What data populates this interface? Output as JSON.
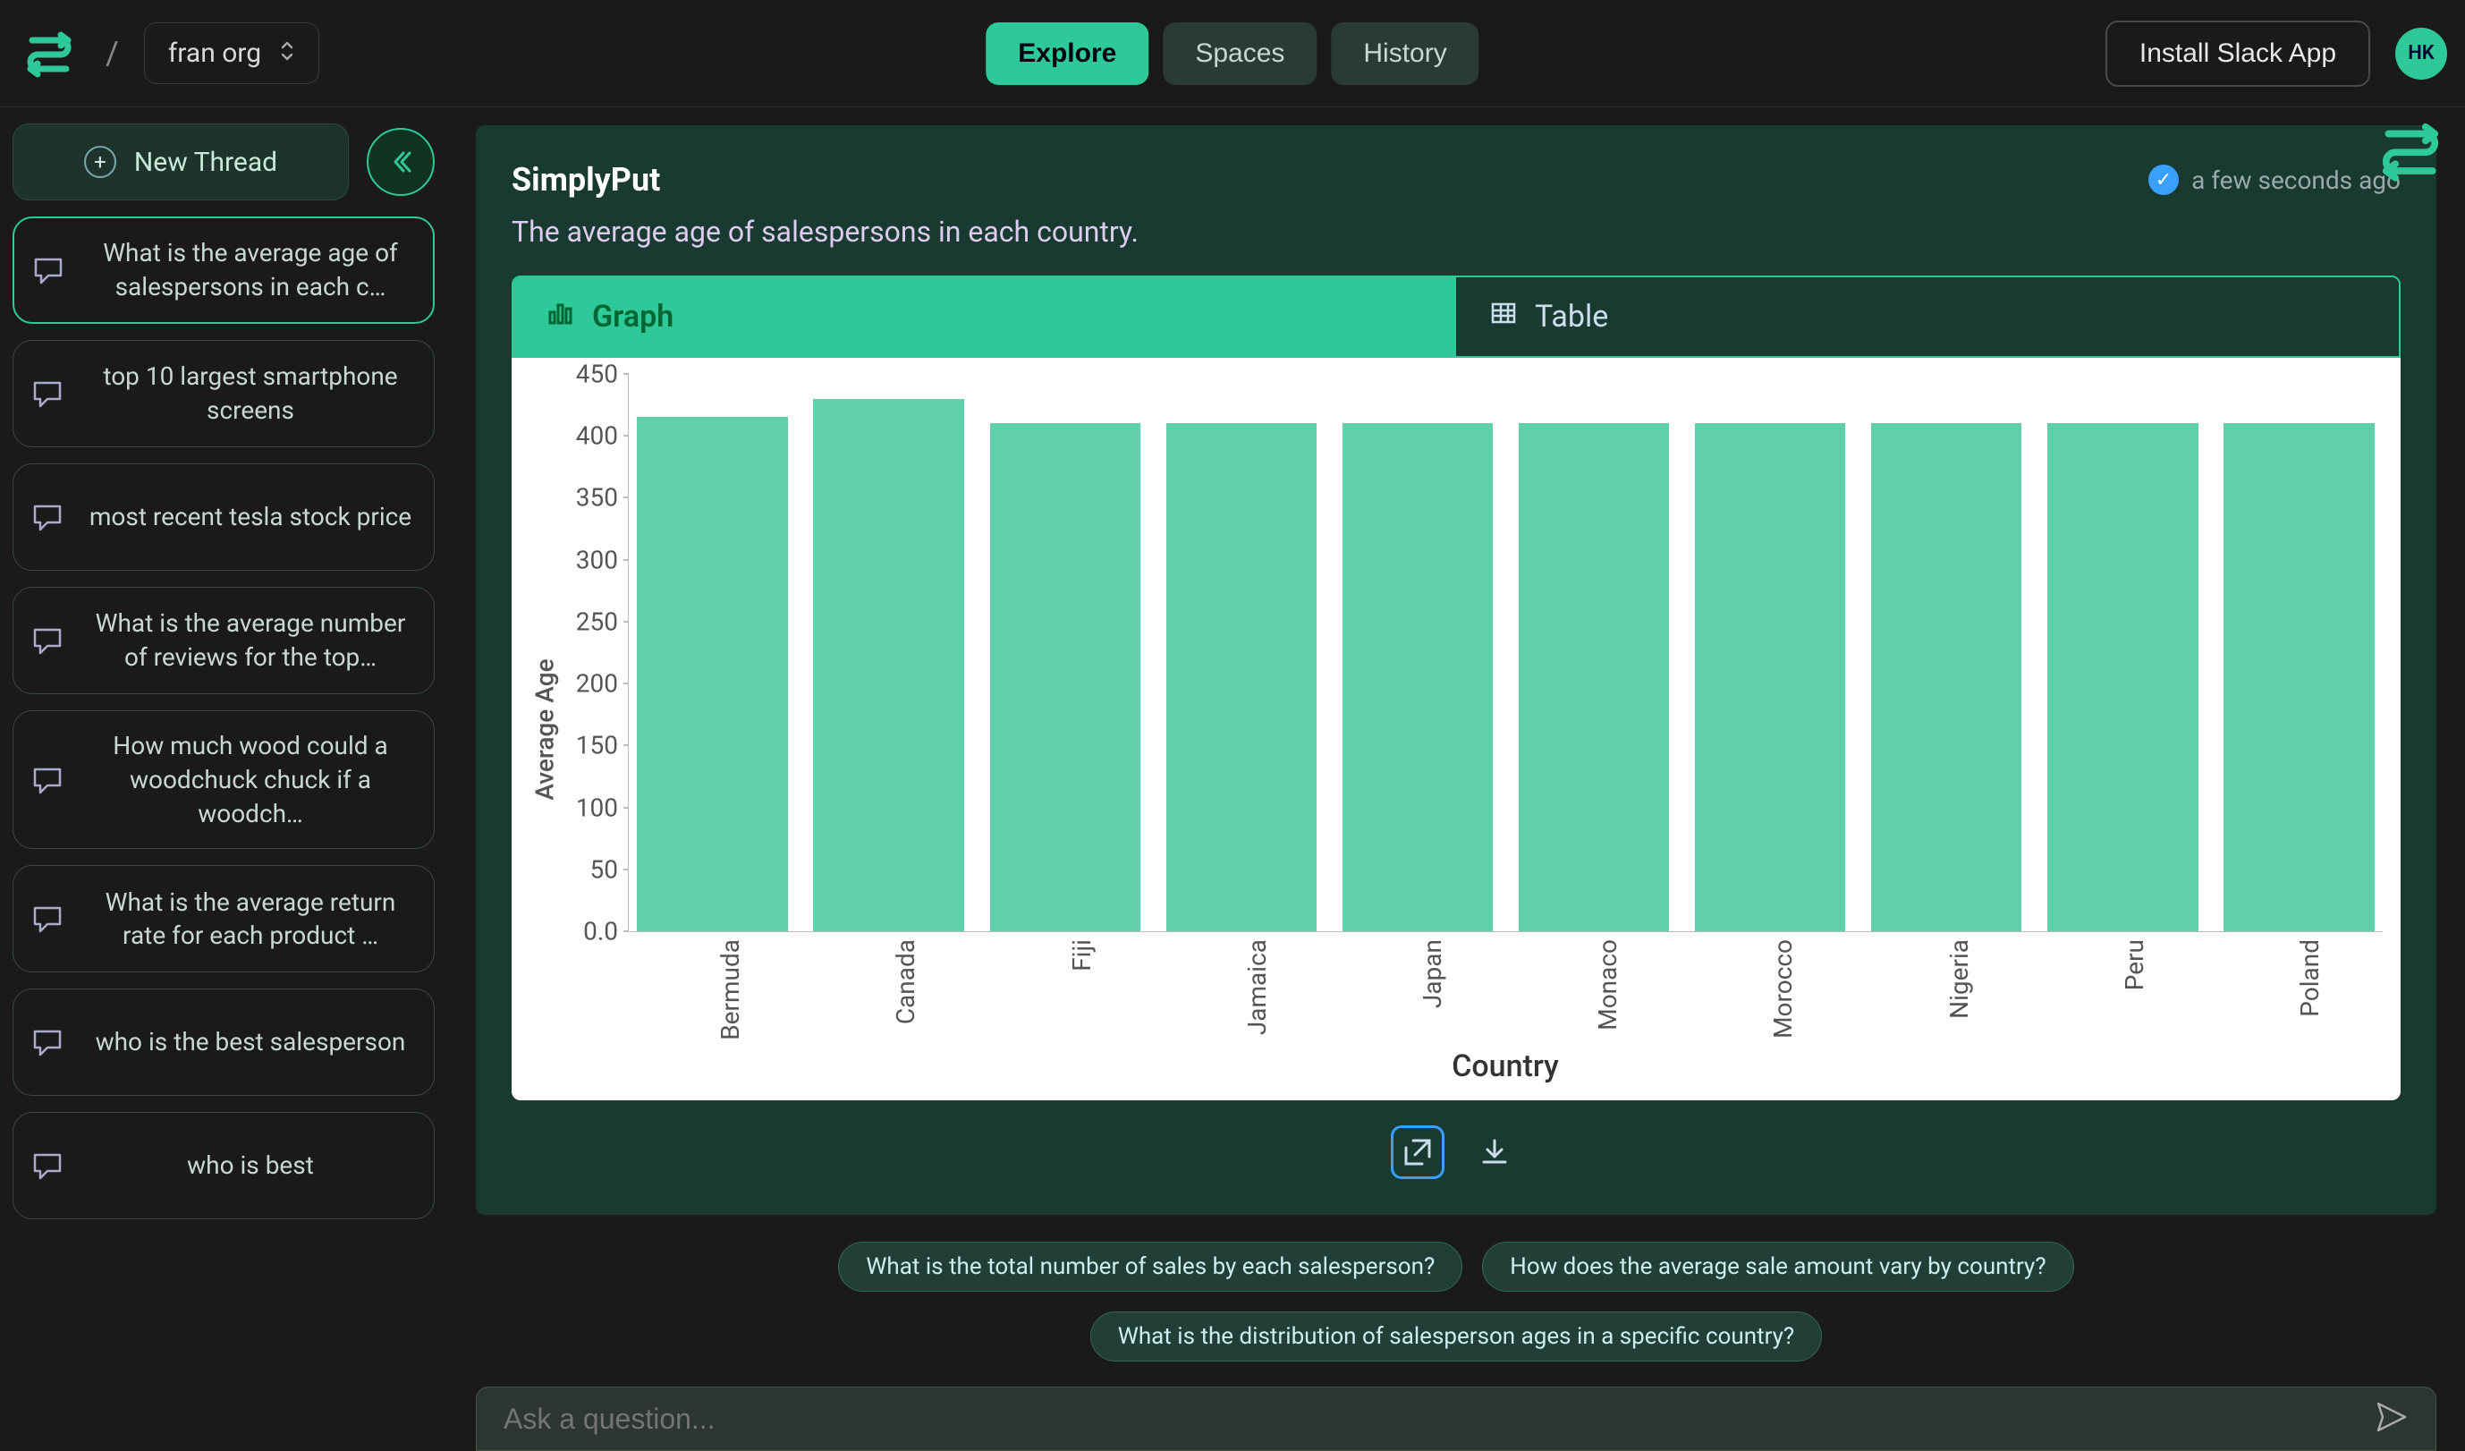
{
  "header": {
    "org_label": "fran org",
    "nav": {
      "explore": "Explore",
      "spaces": "Spaces",
      "history": "History"
    },
    "install_btn": "Install Slack App",
    "avatar_initials": "HK"
  },
  "sidebar": {
    "new_thread": "New Thread",
    "threads": [
      "What is the average age of salespersons in each c…",
      "top 10 largest smartphone screens",
      "most recent tesla stock price",
      "What is the average number of reviews for the top…",
      "How much wood could a woodchuck chuck if a woodch…",
      "What is the average return rate for each product …",
      "who is the best salesperson",
      "who is best"
    ]
  },
  "result": {
    "title": "SimplyPut",
    "timestamp": "a few seconds ago",
    "description": "The average age of salespersons in each country.",
    "tabs": {
      "graph": "Graph",
      "table": "Table"
    }
  },
  "chart_data": {
    "type": "bar",
    "title": "",
    "xlabel": "Country",
    "ylabel": "Average Age",
    "ylim": [
      0,
      450
    ],
    "yticks": [
      0.0,
      50,
      100,
      150,
      200,
      250,
      300,
      350,
      400,
      450
    ],
    "categories": [
      "Bermuda",
      "Canada",
      "Fiji",
      "Jamaica",
      "Japan",
      "Monaco",
      "Morocco",
      "Nigeria",
      "Peru",
      "Poland"
    ],
    "values": [
      415,
      430,
      410,
      410,
      410,
      410,
      410,
      410,
      410,
      410
    ]
  },
  "suggestions": [
    "What is the total number of sales by each salesperson?",
    "How does the average sale amount vary by country?",
    "What is the distribution of salesperson ages in a specific country?"
  ],
  "compose": {
    "placeholder": "Ask a question..."
  }
}
